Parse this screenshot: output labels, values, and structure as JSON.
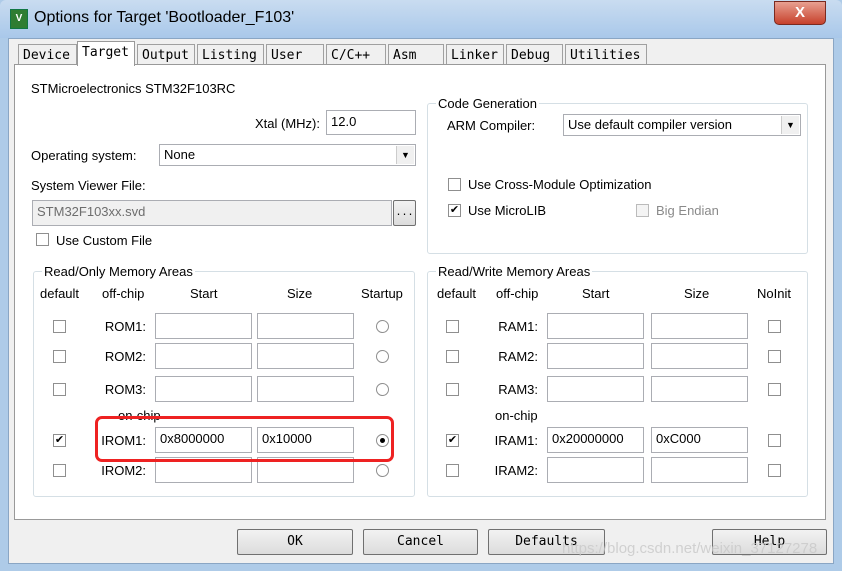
{
  "window": {
    "title": "Options for Target 'Bootloader_F103'",
    "close": "X"
  },
  "tabs": [
    {
      "label": "Device"
    },
    {
      "label": "Target",
      "active": true
    },
    {
      "label": "Output"
    },
    {
      "label": "Listing"
    },
    {
      "label": "User"
    },
    {
      "label": "C/C++"
    },
    {
      "label": "Asm"
    },
    {
      "label": "Linker"
    },
    {
      "label": "Debug"
    },
    {
      "label": "Utilities"
    }
  ],
  "device": {
    "name": "STMicroelectronics STM32F103RC",
    "xtal_label": "Xtal (MHz):",
    "xtal_value": "12.0",
    "os_label": "Operating system:",
    "os_value": "None",
    "svf_label": "System Viewer File:",
    "svf_value": "STM32F103xx.svd",
    "browse": "...",
    "custom_file_label": "Use Custom File",
    "custom_file_checked": false
  },
  "code_generation": {
    "title": "Code Generation",
    "compiler_label": "ARM Compiler:",
    "compiler_value": "Use default compiler version",
    "cross_module_label": "Use Cross-Module Optimization",
    "cross_module_checked": false,
    "microlib_label": "Use MicroLIB",
    "microlib_checked": true,
    "big_endian_label": "Big Endian",
    "big_endian_checked": false
  },
  "ro_memory": {
    "title": "Read/Only Memory Areas",
    "headers": {
      "default": "default",
      "offchip": "off-chip",
      "start": "Start",
      "size": "Size",
      "last": "Startup"
    },
    "onchip_label": "on-chip",
    "rows": [
      {
        "name": "ROM1:",
        "default": false,
        "start": "",
        "size": "",
        "startup": false
      },
      {
        "name": "ROM2:",
        "default": false,
        "start": "",
        "size": "",
        "startup": false
      },
      {
        "name": "ROM3:",
        "default": false,
        "start": "",
        "size": "",
        "startup": false
      },
      {
        "name": "IROM1:",
        "default": true,
        "start": "0x8000000",
        "size": "0x10000",
        "startup": true
      },
      {
        "name": "IROM2:",
        "default": false,
        "start": "",
        "size": "",
        "startup": false
      }
    ]
  },
  "rw_memory": {
    "title": "Read/Write Memory Areas",
    "headers": {
      "default": "default",
      "offchip": "off-chip",
      "start": "Start",
      "size": "Size",
      "last": "NoInit"
    },
    "onchip_label": "on-chip",
    "rows": [
      {
        "name": "RAM1:",
        "default": false,
        "start": "",
        "size": "",
        "noinit": false
      },
      {
        "name": "RAM2:",
        "default": false,
        "start": "",
        "size": "",
        "noinit": false
      },
      {
        "name": "RAM3:",
        "default": false,
        "start": "",
        "size": "",
        "noinit": false
      },
      {
        "name": "IRAM1:",
        "default": true,
        "start": "0x20000000",
        "size": "0xC000",
        "noinit": false
      },
      {
        "name": "IRAM2:",
        "default": false,
        "start": "",
        "size": "",
        "noinit": false
      }
    ]
  },
  "buttons": {
    "ok": "OK",
    "cancel": "Cancel",
    "defaults": "Defaults",
    "help": "Help"
  },
  "watermark": "https://blog.csdn.net/weixin_37127278",
  "colors": {
    "highlight": "#ee2222",
    "titlebar": "#b9d3ee"
  }
}
